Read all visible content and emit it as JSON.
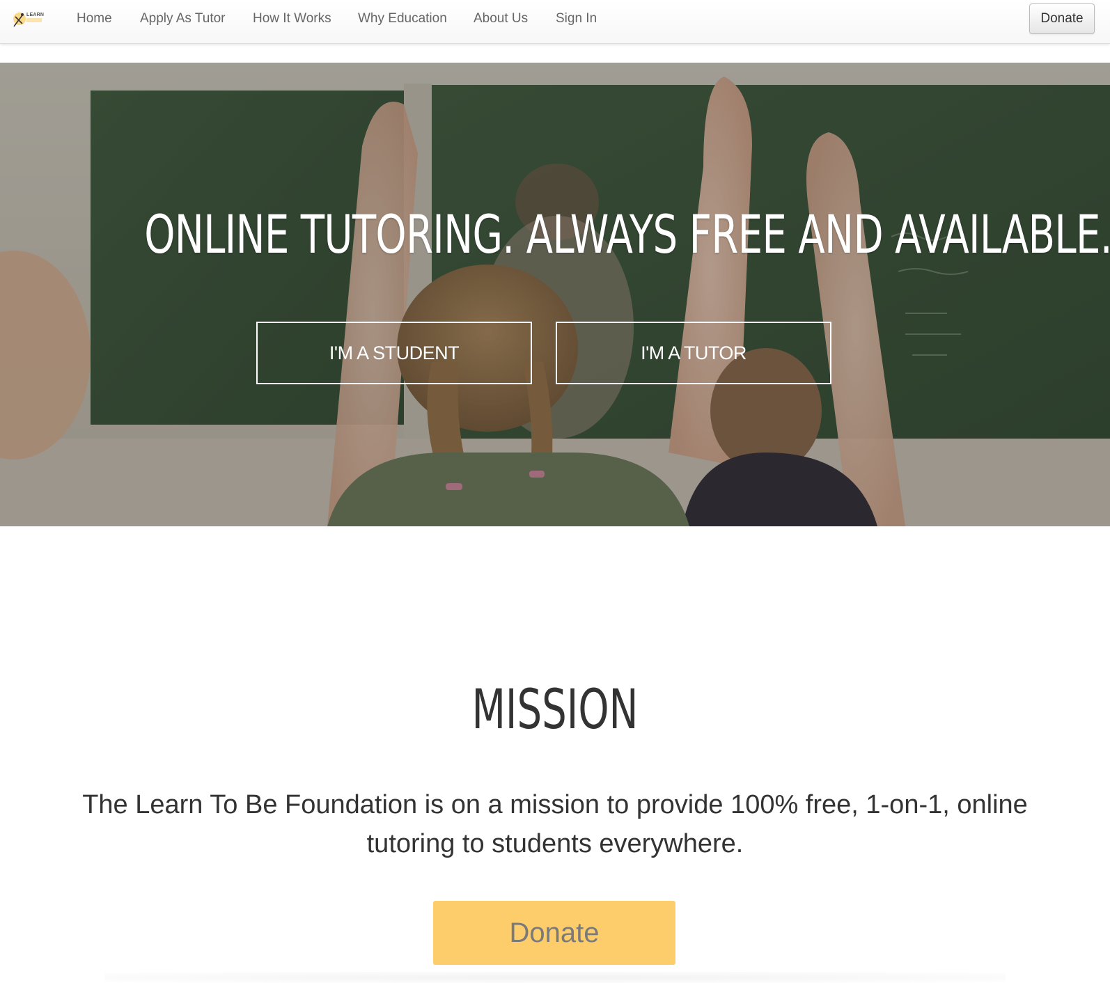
{
  "logo": {
    "text": "LEARN",
    "icon": "learn-to-be-logo-icon"
  },
  "nav": {
    "items": [
      {
        "label": "Home"
      },
      {
        "label": "Apply As Tutor"
      },
      {
        "label": "How It Works"
      },
      {
        "label": "Why Education"
      },
      {
        "label": "About Us"
      },
      {
        "label": "Sign In"
      }
    ],
    "donate_label": "Donate"
  },
  "hero": {
    "title": "ONLINE TUTORING. ALWAYS FREE AND AVAILABLE.",
    "student_button": "I'M A STUDENT",
    "tutor_button": "I'M A TUTOR"
  },
  "mission": {
    "title": "MISSION",
    "text": "The Learn To Be Foundation is on a mission to provide 100% free, 1-on-1, online tutoring to students everywhere.",
    "donate_label": "Donate"
  },
  "colors": {
    "accent_yellow": "#fdcd6c",
    "chalkboard_green": "#3f5a3c",
    "nav_text": "#666666",
    "body_text": "#333333"
  }
}
